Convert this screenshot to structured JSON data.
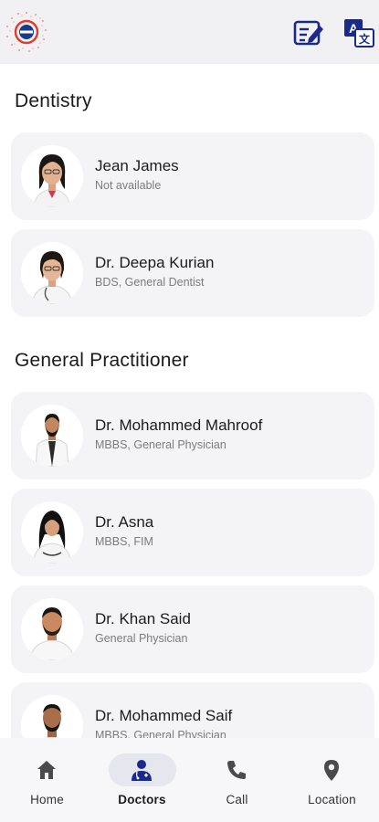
{
  "header": {
    "logo_icon": "clinic-logo-icon",
    "actions": [
      {
        "icon": "edit-note-icon",
        "color": "#1a2a8a"
      },
      {
        "icon": "translate-icon",
        "color": "#1a2a8a"
      }
    ]
  },
  "sections": [
    {
      "title": "Dentistry",
      "doctors": [
        {
          "name": "Jean James",
          "subtitle": "Not available"
        },
        {
          "name": "Dr. Deepa Kurian",
          "subtitle": "BDS, General Dentist"
        }
      ]
    },
    {
      "title": "General Practitioner",
      "doctors": [
        {
          "name": "Dr. Mohammed Mahroof",
          "subtitle": "MBBS, General Physician"
        },
        {
          "name": "Dr. Asna",
          "subtitle": "MBBS, FIM"
        },
        {
          "name": "Dr. Khan Said",
          "subtitle": "General Physician"
        },
        {
          "name": "Dr. Mohammed Saif",
          "subtitle": "MBBS, General Physician"
        }
      ]
    }
  ],
  "nav": {
    "items": [
      {
        "label": "Home",
        "icon": "home-icon"
      },
      {
        "label": "Doctors",
        "icon": "doctor-icon",
        "active": true
      },
      {
        "label": "Call",
        "icon": "phone-icon"
      },
      {
        "label": "Location",
        "icon": "location-pin-icon"
      }
    ],
    "active_color": "#1a2a8a",
    "inactive_color": "#444444"
  }
}
